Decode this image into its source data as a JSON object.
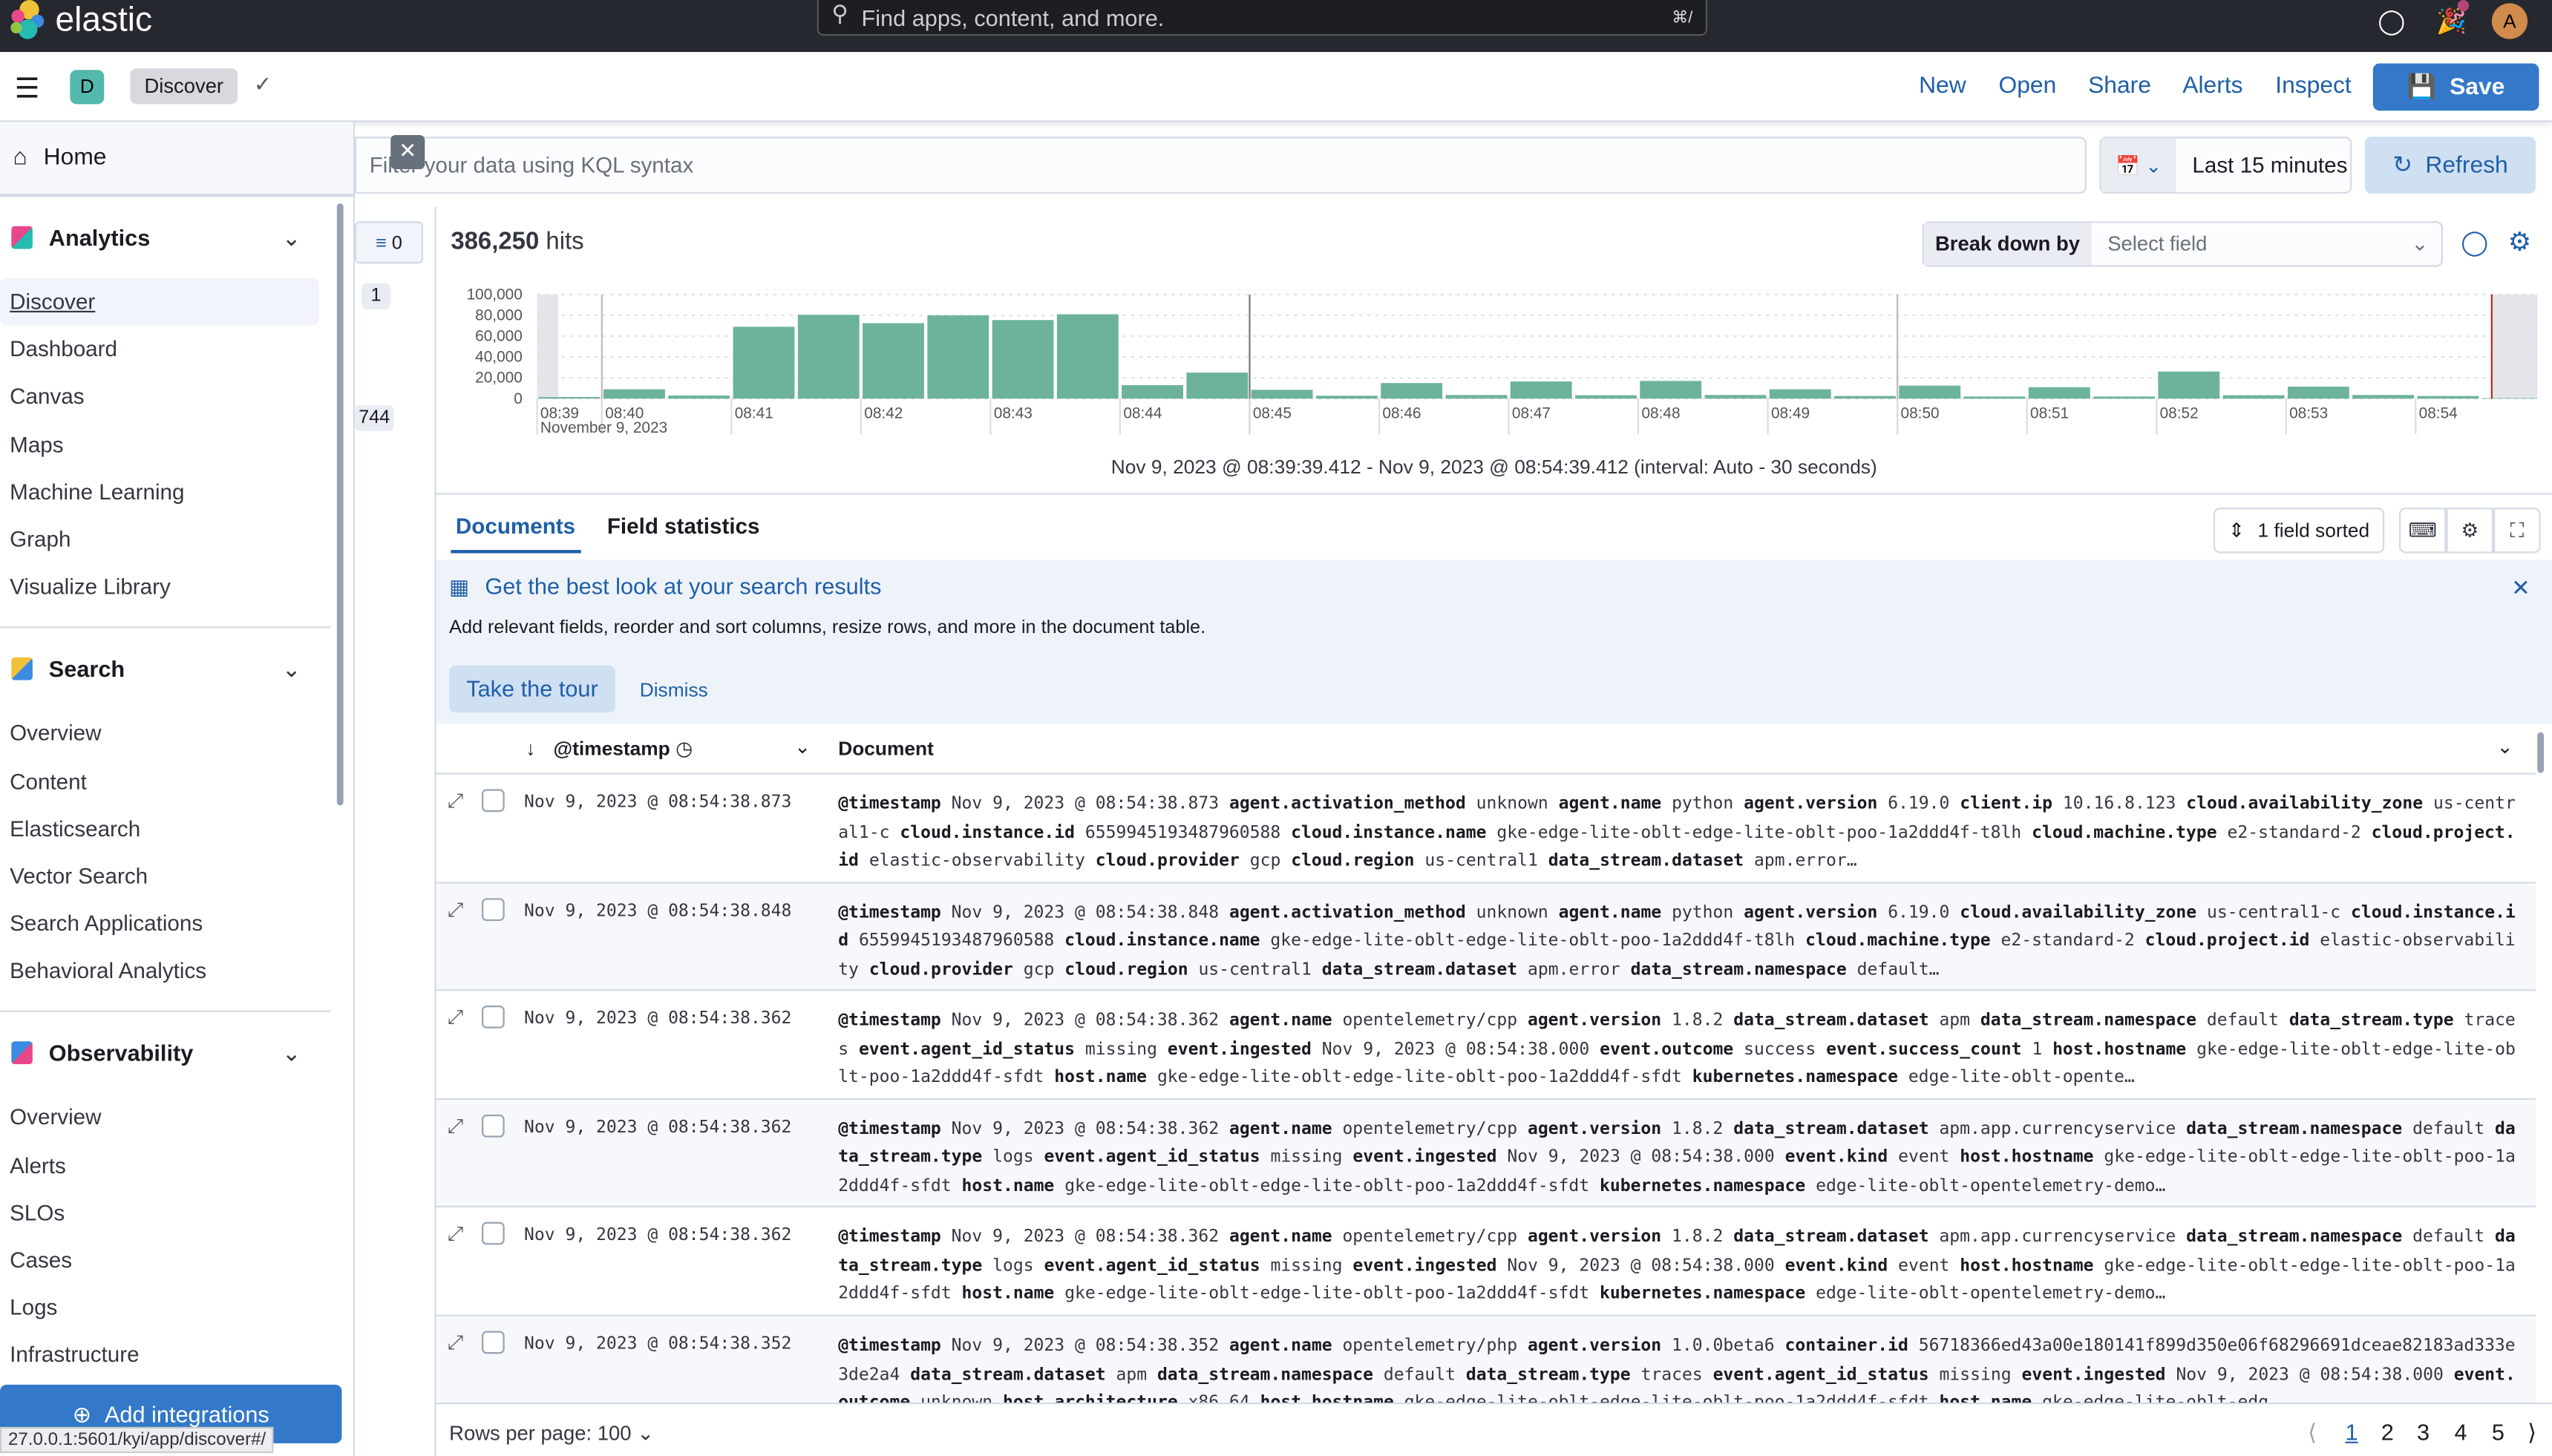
{
  "header": {
    "brand": "elastic",
    "search_placeholder": "Find apps, content, and more.",
    "search_shortcut": "⌘/",
    "avatar_initial": "A",
    "help_icon": "lifebuoy-icon",
    "news_icon": "party-popper-icon"
  },
  "navbar": {
    "space_initial": "D",
    "app_name": "Discover",
    "links": [
      "New",
      "Open",
      "Share",
      "Alerts",
      "Inspect"
    ],
    "save_label": "Save"
  },
  "sidebar": {
    "home": "Home",
    "groups": [
      {
        "title": "Analytics",
        "items": [
          "Discover",
          "Dashboard",
          "Canvas",
          "Maps",
          "Machine Learning",
          "Graph",
          "Visualize Library"
        ],
        "active": "Discover"
      },
      {
        "title": "Search",
        "items": [
          "Overview",
          "Content",
          "Elasticsearch",
          "Vector Search",
          "Search Applications",
          "Behavioral Analytics"
        ]
      },
      {
        "title": "Observability",
        "items": [
          "Overview",
          "Alerts",
          "SLOs",
          "Cases",
          "Logs",
          "Infrastructure"
        ]
      }
    ],
    "add_integrations": "Add integrations"
  },
  "status_url": "27.0.0.1:5601/kyi/app/discover#/",
  "query": {
    "placeholder": "Filter your data using KQL syntax",
    "date_range": "Last 15 minutes",
    "refresh_label": "Refresh"
  },
  "field_list": {
    "filter_count": "0",
    "badge_1": "1",
    "badge_2": "744"
  },
  "hits": {
    "count": "386,250",
    "label": "hits"
  },
  "breakdown": {
    "label": "Break down by",
    "placeholder": "Select field"
  },
  "chart_data": {
    "type": "bar",
    "x_interval": "30 seconds",
    "categories": [
      "08:39:30",
      "08:40:00",
      "08:40:30",
      "08:41:00",
      "08:41:30",
      "08:42:00",
      "08:42:30",
      "08:43:00",
      "08:43:30",
      "08:44:00",
      "08:44:30",
      "08:45:00",
      "08:45:30",
      "08:46:00",
      "08:46:30",
      "08:47:00",
      "08:47:30",
      "08:48:00",
      "08:48:30",
      "08:49:00",
      "08:49:30",
      "08:50:00",
      "08:50:30",
      "08:51:00",
      "08:51:30",
      "08:52:00",
      "08:52:30",
      "08:53:00",
      "08:53:30",
      "08:54:00",
      "08:54:30"
    ],
    "values": [
      1500,
      9000,
      3000,
      69000,
      80500,
      72500,
      80000,
      75500,
      81000,
      13000,
      25000,
      8500,
      2800,
      15000,
      3500,
      16500,
      3300,
      17000,
      3500,
      9000,
      2500,
      12500,
      2000,
      11000,
      2000,
      26000,
      3300,
      11500,
      3500,
      2500,
      500
    ],
    "ylim": [
      0,
      100000
    ],
    "y_ticks": [
      "100,000",
      "80,000",
      "60,000",
      "40,000",
      "20,000",
      "0"
    ],
    "x_ticks": [
      "08:39",
      "08:40",
      "08:41",
      "08:42",
      "08:43",
      "08:44",
      "08:45",
      "08:46",
      "08:47",
      "08:48",
      "08:49",
      "08:50",
      "08:51",
      "08:52",
      "08:53",
      "08:54"
    ],
    "x_date_label": "November 9, 2023",
    "bar_color": "#6db39a",
    "now_marker_color": "#bd271e",
    "grid": true
  },
  "time_range_caption": "Nov 9, 2023 @ 08:39:39.412 - Nov 9, 2023 @ 08:54:39.412 (interval: Auto - 30 seconds)",
  "tabs": {
    "documents": "Documents",
    "field_statistics": "Field statistics",
    "sorted": "1 field sorted"
  },
  "callout": {
    "title": "Get the best look at your search results",
    "body": "Add relevant fields, reorder and sort columns, resize rows, and more in the document table.",
    "tour": "Take the tour",
    "dismiss": "Dismiss"
  },
  "table": {
    "col_timestamp": "@timestamp",
    "col_document": "Document",
    "rows": [
      {
        "ts": "Nov 9, 2023 @ 08:54:38.873",
        "doc": [
          [
            "@timestamp",
            "Nov 9, 2023 @ 08:54:38.873"
          ],
          [
            "agent.activation_method",
            "unknown"
          ],
          [
            "agent.name",
            "python"
          ],
          [
            "agent.version",
            "6.19.0"
          ],
          [
            "client.ip",
            "10.16.8.123"
          ],
          [
            "cloud.availability_zone",
            "us-central1-c"
          ],
          [
            "cloud.instance.id",
            "6559945193487960588"
          ],
          [
            "cloud.instance.name",
            "gke-edge-lite-oblt-edge-lite-oblt-poo-1a2ddd4f-t8lh"
          ],
          [
            "cloud.machine.type",
            "e2-standard-2"
          ],
          [
            "cloud.project.id",
            "elastic-observability"
          ],
          [
            "cloud.provider",
            "gcp"
          ],
          [
            "cloud.region",
            "us-central1"
          ],
          [
            "data_stream.dataset",
            "apm.error…"
          ]
        ]
      },
      {
        "ts": "Nov 9, 2023 @ 08:54:38.848",
        "doc": [
          [
            "@timestamp",
            "Nov 9, 2023 @ 08:54:38.848"
          ],
          [
            "agent.activation_method",
            "unknown"
          ],
          [
            "agent.name",
            "python"
          ],
          [
            "agent.version",
            "6.19.0"
          ],
          [
            "cloud.availability_zone",
            "us-central1-c"
          ],
          [
            "cloud.instance.id",
            "6559945193487960588"
          ],
          [
            "cloud.instance.name",
            "gke-edge-lite-oblt-edge-lite-oblt-poo-1a2ddd4f-t8lh"
          ],
          [
            "cloud.machine.type",
            "e2-standard-2"
          ],
          [
            "cloud.project.id",
            "elastic-observability"
          ],
          [
            "cloud.provider",
            "gcp"
          ],
          [
            "cloud.region",
            "us-central1"
          ],
          [
            "data_stream.dataset",
            "apm.error"
          ],
          [
            "data_stream.namespace",
            "default…"
          ]
        ]
      },
      {
        "ts": "Nov 9, 2023 @ 08:54:38.362",
        "doc": [
          [
            "@timestamp",
            "Nov 9, 2023 @ 08:54:38.362"
          ],
          [
            "agent.name",
            "opentelemetry/cpp"
          ],
          [
            "agent.version",
            "1.8.2"
          ],
          [
            "data_stream.dataset",
            "apm"
          ],
          [
            "data_stream.namespace",
            "default"
          ],
          [
            "data_stream.type",
            "traces"
          ],
          [
            "event.agent_id_status",
            "missing"
          ],
          [
            "event.ingested",
            "Nov 9, 2023 @ 08:54:38.000"
          ],
          [
            "event.outcome",
            "success"
          ],
          [
            "event.success_count",
            "1"
          ],
          [
            "host.hostname",
            "gke-edge-lite-oblt-edge-lite-oblt-poo-1a2ddd4f-sfdt"
          ],
          [
            "host.name",
            "gke-edge-lite-oblt-edge-lite-oblt-poo-1a2ddd4f-sfdt"
          ],
          [
            "kubernetes.namespace",
            "edge-lite-oblt-opente…"
          ]
        ]
      },
      {
        "ts": "Nov 9, 2023 @ 08:54:38.362",
        "doc": [
          [
            "@timestamp",
            "Nov 9, 2023 @ 08:54:38.362"
          ],
          [
            "agent.name",
            "opentelemetry/cpp"
          ],
          [
            "agent.version",
            "1.8.2"
          ],
          [
            "data_stream.dataset",
            "apm.app.currencyservice"
          ],
          [
            "data_stream.namespace",
            "default"
          ],
          [
            "data_stream.type",
            "logs"
          ],
          [
            "event.agent_id_status",
            "missing"
          ],
          [
            "event.ingested",
            "Nov 9, 2023 @ 08:54:38.000"
          ],
          [
            "event.kind",
            "event"
          ],
          [
            "host.hostname",
            "gke-edge-lite-oblt-edge-lite-oblt-poo-1a2ddd4f-sfdt"
          ],
          [
            "host.name",
            "gke-edge-lite-oblt-edge-lite-oblt-poo-1a2ddd4f-sfdt"
          ],
          [
            "kubernetes.namespace",
            "edge-lite-oblt-opentelemetry-demo…"
          ]
        ]
      },
      {
        "ts": "Nov 9, 2023 @ 08:54:38.362",
        "doc": [
          [
            "@timestamp",
            "Nov 9, 2023 @ 08:54:38.362"
          ],
          [
            "agent.name",
            "opentelemetry/cpp"
          ],
          [
            "agent.version",
            "1.8.2"
          ],
          [
            "data_stream.dataset",
            "apm.app.currencyservice"
          ],
          [
            "data_stream.namespace",
            "default"
          ],
          [
            "data_stream.type",
            "logs"
          ],
          [
            "event.agent_id_status",
            "missing"
          ],
          [
            "event.ingested",
            "Nov 9, 2023 @ 08:54:38.000"
          ],
          [
            "event.kind",
            "event"
          ],
          [
            "host.hostname",
            "gke-edge-lite-oblt-edge-lite-oblt-poo-1a2ddd4f-sfdt"
          ],
          [
            "host.name",
            "gke-edge-lite-oblt-edge-lite-oblt-poo-1a2ddd4f-sfdt"
          ],
          [
            "kubernetes.namespace",
            "edge-lite-oblt-opentelemetry-demo…"
          ]
        ]
      },
      {
        "ts": "Nov 9, 2023 @ 08:54:38.352",
        "doc": [
          [
            "@timestamp",
            "Nov 9, 2023 @ 08:54:38.352"
          ],
          [
            "agent.name",
            "opentelemetry/php"
          ],
          [
            "agent.version",
            "1.0.0beta6"
          ],
          [
            "container.id",
            "56718366ed43a00e180141f899d350e06f68296691dceae82183ad333e3de2a4"
          ],
          [
            "data_stream.dataset",
            "apm"
          ],
          [
            "data_stream.namespace",
            "default"
          ],
          [
            "data_stream.type",
            "traces"
          ],
          [
            "event.agent_id_status",
            "missing"
          ],
          [
            "event.ingested",
            "Nov 9, 2023 @ 08:54:38.000"
          ],
          [
            "event.outcome",
            "unknown"
          ],
          [
            "host.architecture",
            "x86_64"
          ],
          [
            "host.hostname",
            "gke-edge-lite-oblt-edge-lite-oblt-poo-1a2ddd4f-sfdt"
          ],
          [
            "host.name",
            "gke-edge-lite-oblt-edg"
          ]
        ]
      }
    ]
  },
  "footer": {
    "rows_per_page": "Rows per page: 100",
    "pages": [
      "1",
      "2",
      "3",
      "4",
      "5"
    ],
    "current_page": "1"
  },
  "colors": {
    "accent": "#3378c9",
    "link": "#1f5fa8",
    "header_bg": "#25282f"
  }
}
